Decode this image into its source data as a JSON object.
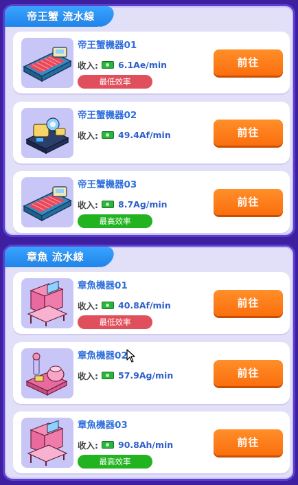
{
  "sections": [
    {
      "title": "帝王蟹 流水線",
      "machines": [
        {
          "name": "帝王蟹機器01",
          "income_label": "收入:",
          "rate": "6.1Ae/min",
          "badge": "最低效率",
          "badge_type": "low",
          "button": "前往"
        },
        {
          "name": "帝王蟹機器02",
          "income_label": "收入:",
          "rate": "49.4Af/min",
          "badge": "",
          "badge_type": "none",
          "button": "前往"
        },
        {
          "name": "帝王蟹機器03",
          "income_label": "收入:",
          "rate": "8.7Ag/min",
          "badge": "最高效率",
          "badge_type": "high",
          "button": "前往"
        }
      ]
    },
    {
      "title": "章魚 流水線",
      "machines": [
        {
          "name": "章魚機器01",
          "income_label": "收入:",
          "rate": "40.8Af/min",
          "badge": "最低效率",
          "badge_type": "low",
          "button": "前往"
        },
        {
          "name": "章魚機器02",
          "income_label": "收入:",
          "rate": "57.9Ag/min",
          "badge": "",
          "badge_type": "none",
          "button": "前往"
        },
        {
          "name": "章魚機器03",
          "income_label": "收入:",
          "rate": "90.8Ah/min",
          "badge": "最高效率",
          "badge_type": "high",
          "button": "前往"
        }
      ]
    }
  ],
  "icons": {
    "income": "cash-icon",
    "cursor": "mouse-pointer-icon"
  },
  "colors": {
    "background": "#3d1fa0",
    "panel": "#e2dff8",
    "tab": "#2b93f5",
    "button": "#fb7a18",
    "badge_low": "#e0505c",
    "badge_high": "#22b320",
    "name_text": "#2f6fdc"
  }
}
